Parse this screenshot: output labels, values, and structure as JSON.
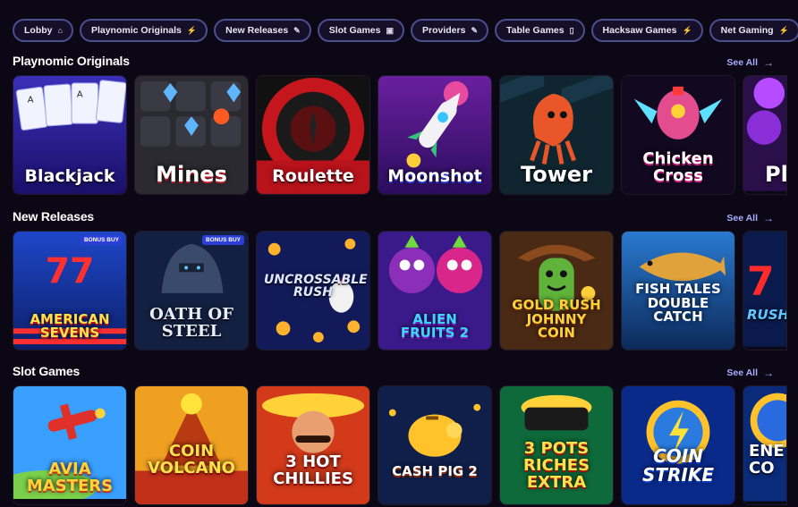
{
  "nav": {
    "pills": [
      {
        "label": "Lobby",
        "icon": "⌂"
      },
      {
        "label": "Playnomic Originals",
        "icon": "⚡"
      },
      {
        "label": "New Releases",
        "icon": "✎"
      },
      {
        "label": "Slot Games",
        "icon": "▣"
      },
      {
        "label": "Providers",
        "icon": "✎"
      },
      {
        "label": "Table Games",
        "icon": "▯"
      },
      {
        "label": "Hacksaw Games",
        "icon": "⚡"
      },
      {
        "label": "Net Gaming",
        "icon": "⚡"
      }
    ]
  },
  "sections": [
    {
      "title": "Playnomic Originals",
      "see_all": "See All",
      "games": [
        {
          "name": "Blackjack"
        },
        {
          "name": "Mines"
        },
        {
          "name": "Roulette"
        },
        {
          "name": "Moonshot"
        },
        {
          "name": "Tower"
        },
        {
          "name": "Chicken Cross"
        },
        {
          "name": "Pl"
        }
      ]
    },
    {
      "title": "New Releases",
      "see_all": "See All",
      "games": [
        {
          "name": "AMERICAN SEVENS",
          "badge": "BONUS BUY"
        },
        {
          "name": "OATH OF STEEL",
          "badge": "BONUS BUY"
        },
        {
          "name": "UNCROSSABLE RUSH"
        },
        {
          "name": "ALIEN FRUITS 2"
        },
        {
          "name": "GOLD RUSH JOHNNY COIN"
        },
        {
          "name": "FISH TALES DOUBLE CATCH"
        },
        {
          "name": "RUSH"
        }
      ]
    },
    {
      "title": "Slot Games",
      "see_all": "See All",
      "games": [
        {
          "name": "AVIA MASTERS"
        },
        {
          "name": "COIN VOLCANO"
        },
        {
          "name": "3 HOT CHILLIES"
        },
        {
          "name": "CASH PIG 2"
        },
        {
          "name": "3 POTS RICHES EXTRA"
        },
        {
          "name": "COIN STRIKE"
        },
        {
          "name": "ENE CO"
        }
      ]
    }
  ]
}
